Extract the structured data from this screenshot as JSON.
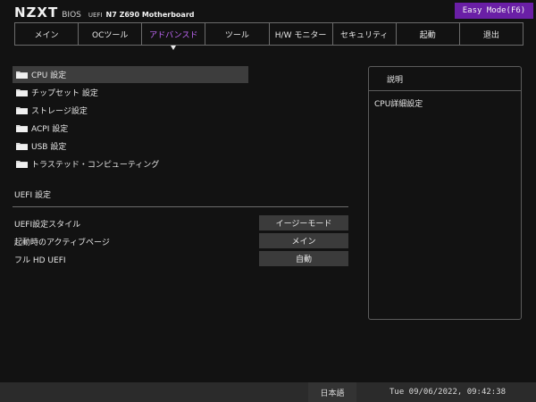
{
  "header": {
    "logo": "NZXT",
    "bios": "BIOS",
    "uefi": "UEFI",
    "model": "N7 Z690 Motherboard",
    "easy_mode": "Easy Mode(F6)"
  },
  "tabs": [
    {
      "label": "メイン",
      "icon": "",
      "active": false
    },
    {
      "label": "OCツール",
      "active": false
    },
    {
      "label": "アドバンスド",
      "active": true
    },
    {
      "label": "ツール",
      "active": false
    },
    {
      "label": "H/W モニター",
      "active": false
    },
    {
      "label": "セキュリティ",
      "active": false
    },
    {
      "label": "起動",
      "active": false
    },
    {
      "label": "退出",
      "active": false
    }
  ],
  "menu": {
    "icon": "folder-icon",
    "items": [
      {
        "label": "CPU 設定",
        "selected": true
      },
      {
        "label": "チップセット 設定",
        "selected": false
      },
      {
        "label": "ストレージ設定",
        "selected": false
      },
      {
        "label": "ACPI 設定",
        "selected": false
      },
      {
        "label": "USB 設定",
        "selected": false
      },
      {
        "label": "トラステッド・コンピューティング",
        "selected": false
      }
    ]
  },
  "uefi_section": {
    "title": "UEFI 設定",
    "settings": [
      {
        "label": "UEFI設定スタイル",
        "value": "イージーモード"
      },
      {
        "label": "起動時のアクティブページ",
        "value": "メイン"
      },
      {
        "label": "フル HD UEFI",
        "value": "自動"
      }
    ]
  },
  "description": {
    "title": "説明",
    "text": "CPU詳細設定"
  },
  "footer": {
    "language": "日本語",
    "datetime": "Tue 09/06/2022, 09:42:38"
  },
  "colors": {
    "accent": "#c66bff",
    "easy_mode_bg": "#6a1fa6",
    "background": "#121212",
    "selected_bg": "#3d3d3d"
  }
}
